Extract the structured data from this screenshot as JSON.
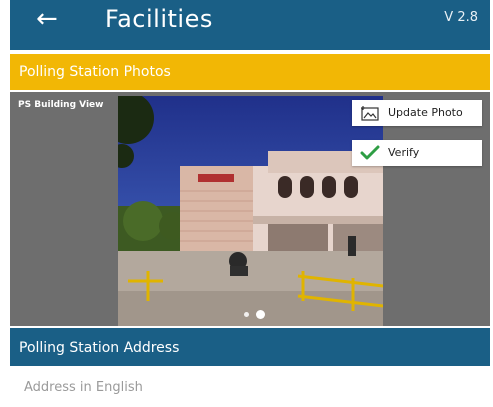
{
  "appbar": {
    "back_icon": "arrow-left-icon",
    "title": "Facilities",
    "version": "V 2.8"
  },
  "photos": {
    "section_title": "Polling Station Photos",
    "image_label": "PS Building View",
    "update_label": "Update Photo",
    "update_icon": "image-upload-icon",
    "verify_label": "Verify",
    "verify_icon": "checkmark-icon",
    "carousel_pages": 2,
    "carousel_active": 2
  },
  "address": {
    "section_title": "Polling Station Address",
    "english_label": "Address in English"
  },
  "colors": {
    "primary": "#1a5f86",
    "accent": "#f2b705",
    "verify_green": "#2e9e44"
  }
}
